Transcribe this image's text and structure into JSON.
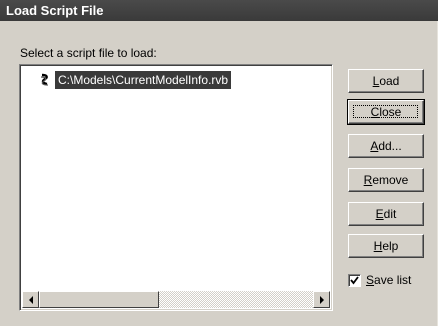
{
  "window": {
    "title": "Load Script File"
  },
  "prompt": "Select a script file to load:",
  "files": [
    {
      "path": "C:\\Models\\CurrentModelInfo.rvb",
      "icon": "script-file-icon",
      "selected": true
    }
  ],
  "buttons": {
    "load": {
      "mnemonic": "L",
      "rest": "oad"
    },
    "close": {
      "mnemonic": "C",
      "rest": "lose"
    },
    "add": {
      "mnemonic": "A",
      "rest": "dd..."
    },
    "remove": {
      "mnemonic": "R",
      "rest": "emove"
    },
    "edit": {
      "mnemonic": "E",
      "rest": "dit"
    },
    "help": {
      "mnemonic": "H",
      "rest": "elp"
    }
  },
  "save_list": {
    "checked": true,
    "mnemonic": "S",
    "rest": "ave list"
  },
  "colors": {
    "titlebar": "#3a3a3a",
    "selection": "#3a3a3a",
    "dialog_bg": "#d4d0c8"
  }
}
